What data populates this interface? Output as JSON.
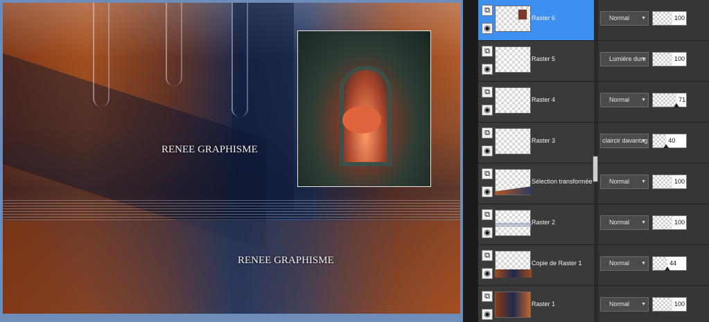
{
  "canvas": {
    "watermark_1": "RENEE GRAPHISME",
    "watermark_2": "RENEE GRAPHISME"
  },
  "layers": [
    {
      "name": "Raster 6",
      "blend": "Normal",
      "opacity": "100",
      "opacity_value": 100,
      "selected": true
    },
    {
      "name": "Raster 5",
      "blend": "Lumière dure",
      "opacity": "100",
      "opacity_value": 100,
      "selected": false
    },
    {
      "name": "Raster 4",
      "blend": "Normal",
      "opacity": "71",
      "opacity_value": 71,
      "selected": false
    },
    {
      "name": "Raster 3",
      "blend": "claircir davantag",
      "opacity": "40",
      "opacity_value": 40,
      "selected": false
    },
    {
      "name": "Sélection transformée",
      "blend": "Normal",
      "opacity": "100",
      "opacity_value": 100,
      "selected": false
    },
    {
      "name": "Raster 2",
      "blend": "Normal",
      "opacity": "100",
      "opacity_value": 100,
      "selected": false
    },
    {
      "name": "Copie de Raster 1",
      "blend": "Normal",
      "opacity": "44",
      "opacity_value": 44,
      "selected": false
    },
    {
      "name": "Raster 1",
      "blend": "Normal",
      "opacity": "100",
      "opacity_value": 100,
      "selected": false
    }
  ],
  "icons": {
    "link": "layer-link-icon",
    "visibility": "eye-icon",
    "dropdown": "chevron-down-icon"
  },
  "colors": {
    "selected": "#3d8ff0",
    "panel": "#2a2a2a",
    "canvas_frame": "#6d8db8"
  }
}
